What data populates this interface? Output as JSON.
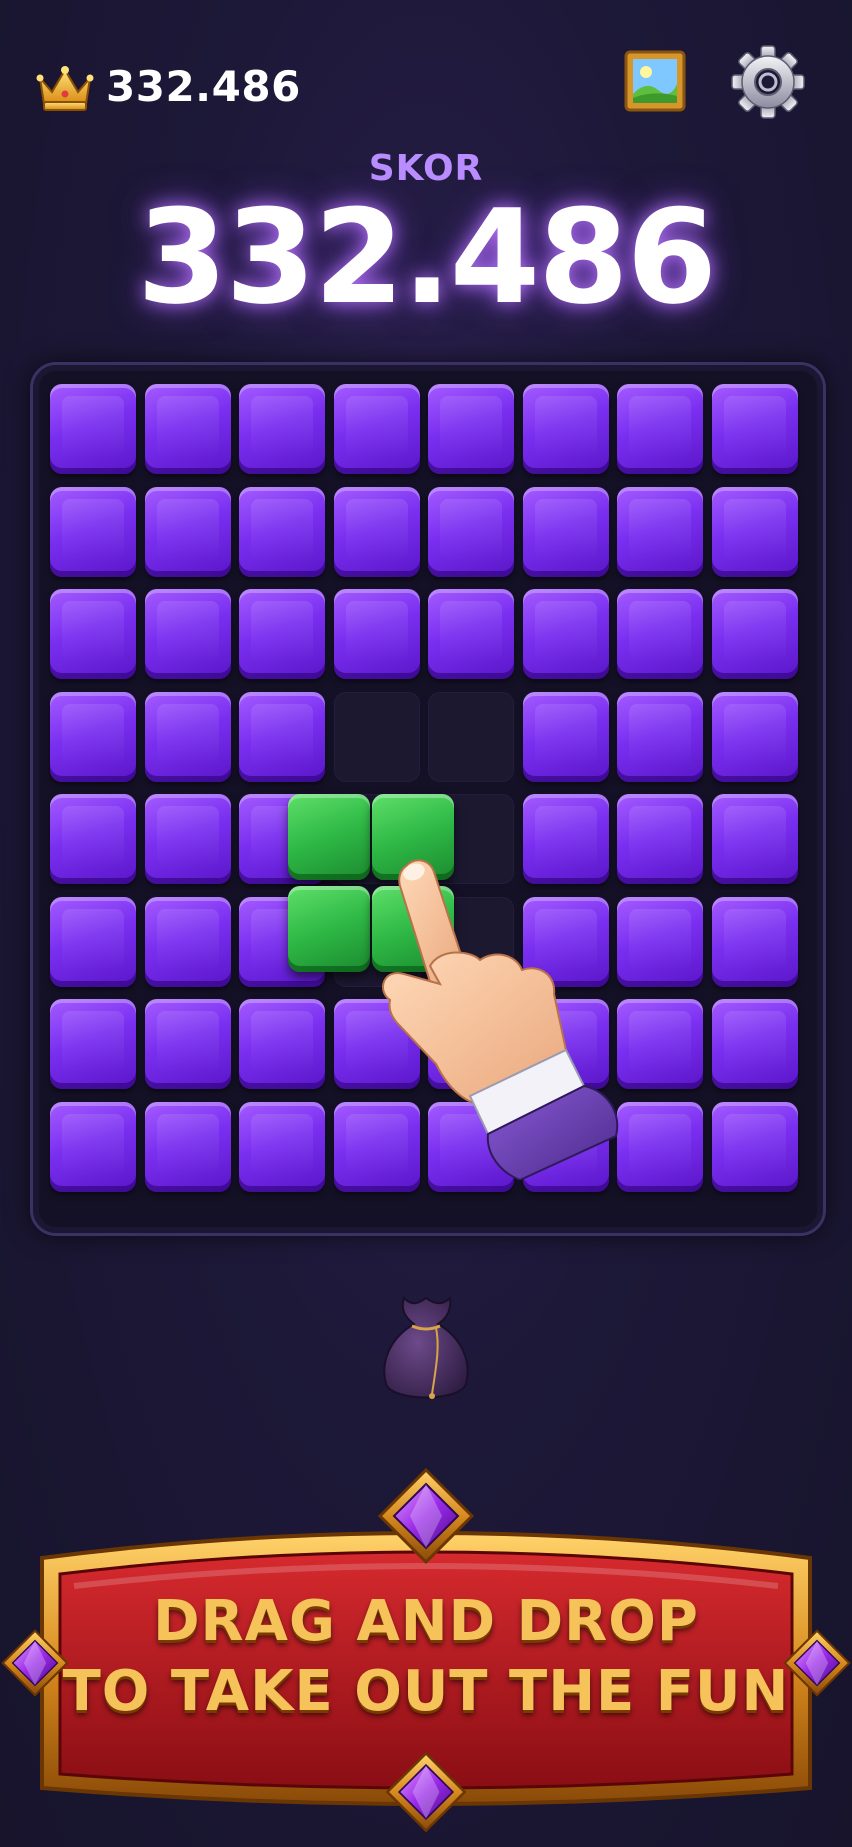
{
  "header": {
    "best_score": "332.486",
    "crown_icon": "crown-icon",
    "gallery_icon": "picture-icon",
    "settings_icon": "gear-icon"
  },
  "score": {
    "label": "SKOR",
    "value": "332.486"
  },
  "board": {
    "rows": 8,
    "cols": 8,
    "cells": [
      "PPPPPPPP",
      "PPPPPPPP",
      "PPPPPPPP",
      "PPP..PPP",
      "PPP..PPP",
      "PPP..PPP",
      "PPPPPPPP",
      "PPPPPPPP"
    ],
    "block_color": "#7a2ff0",
    "empty_color": "#1b1830"
  },
  "dragged_piece": {
    "shape": "2x2 square",
    "color": "#2eb845"
  },
  "hint": {
    "icon": "pointing-hand-icon"
  },
  "tray": {
    "item_icon": "bag-icon"
  },
  "banner": {
    "line1": "DRAG AND DROP",
    "line2": "TO TAKE OUT THE FUN",
    "text_color": "#f6c35a",
    "background_color": "#b3161c",
    "gem_icon": "purple-gem-icon"
  }
}
